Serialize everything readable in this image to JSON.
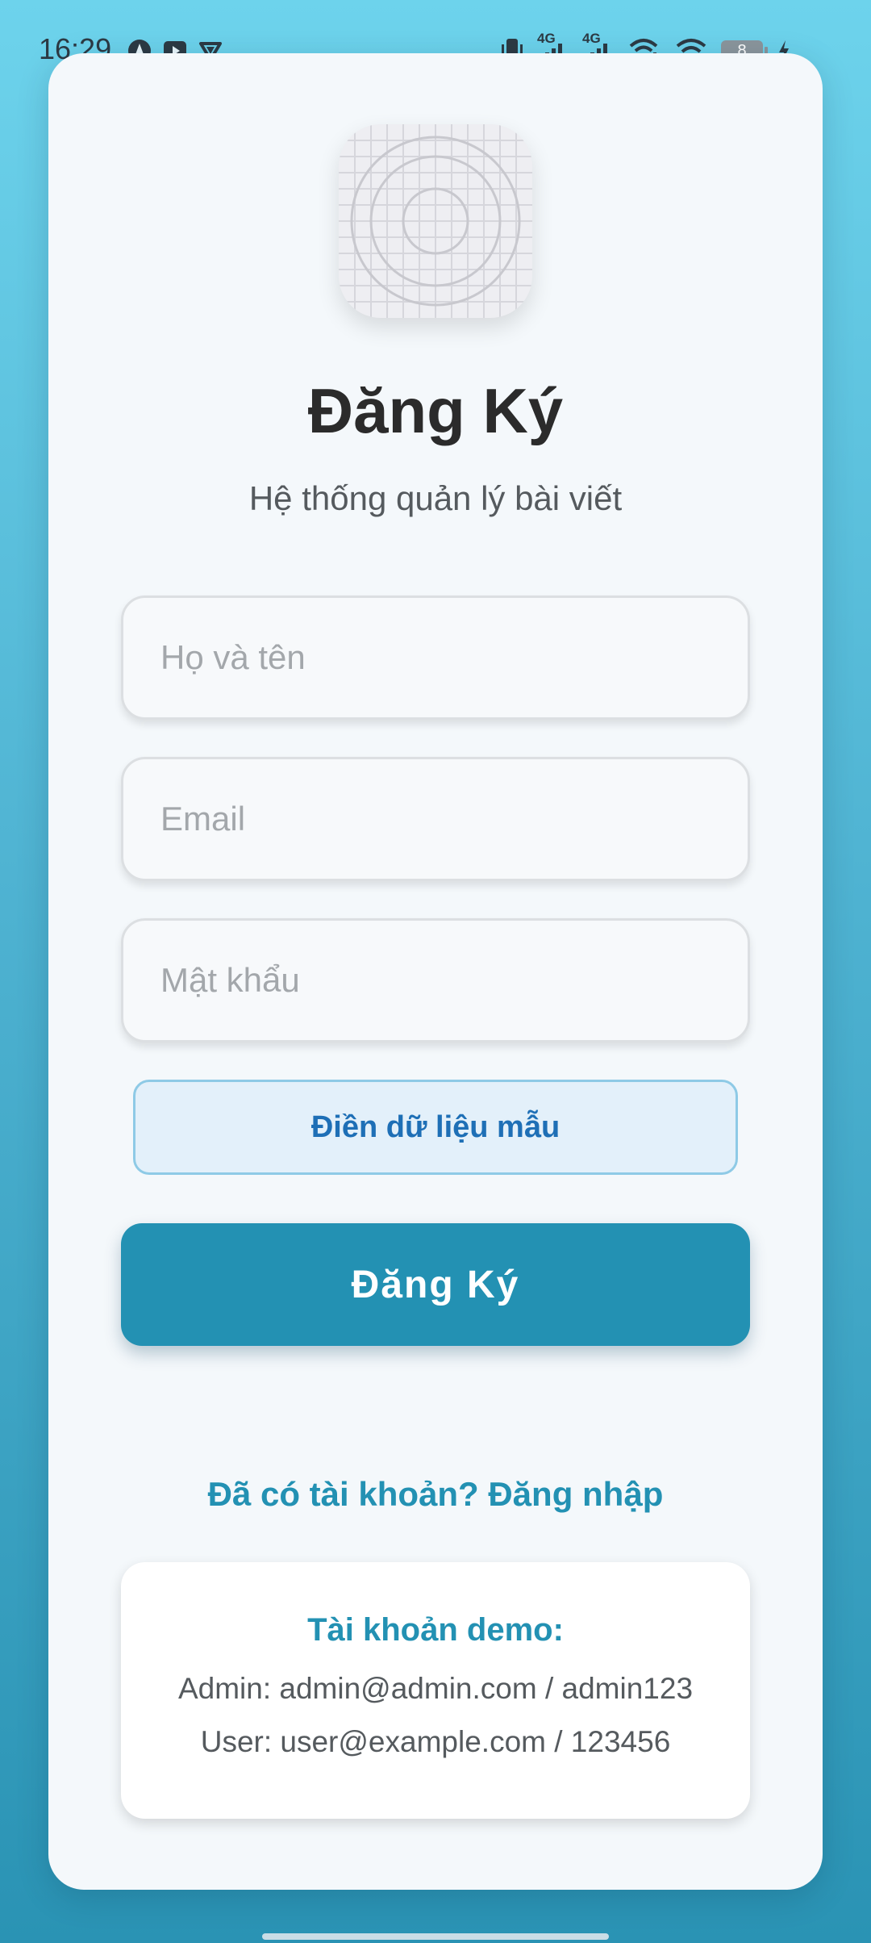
{
  "status_bar": {
    "time": "16:29",
    "left_icons": [
      "navigation-icon",
      "youtube-icon",
      "vpn-icon"
    ],
    "right_icons": [
      "vibrate-icon",
      "signal-4g-icon",
      "signal-4g-icon",
      "wifi-calling-icon",
      "wifi-icon",
      "battery-icon",
      "charging-icon"
    ],
    "signal_label": "4G",
    "battery_level": "8"
  },
  "app": {
    "icon": "app-placeholder-icon"
  },
  "header": {
    "title": "Đăng Ký",
    "subtitle": "Hệ thống quản lý bài viết"
  },
  "form": {
    "name_placeholder": "Họ và tên",
    "email_placeholder": "Email",
    "password_placeholder": "Mật khẩu",
    "fill_sample_label": "Điền dữ liệu mẫu",
    "submit_label": "Đăng Ký"
  },
  "login_link": "Đã có tài khoản? Đăng nhập",
  "demo": {
    "title": "Tài khoản demo:",
    "admin": "Admin: admin@admin.com / admin123",
    "user": "User: user@example.com / 123456"
  },
  "colors": {
    "accent": "#2391b3",
    "fill_button_text": "#1e6fb6",
    "background_top": "#6dd3ec",
    "background_bottom": "#2a93b4"
  }
}
